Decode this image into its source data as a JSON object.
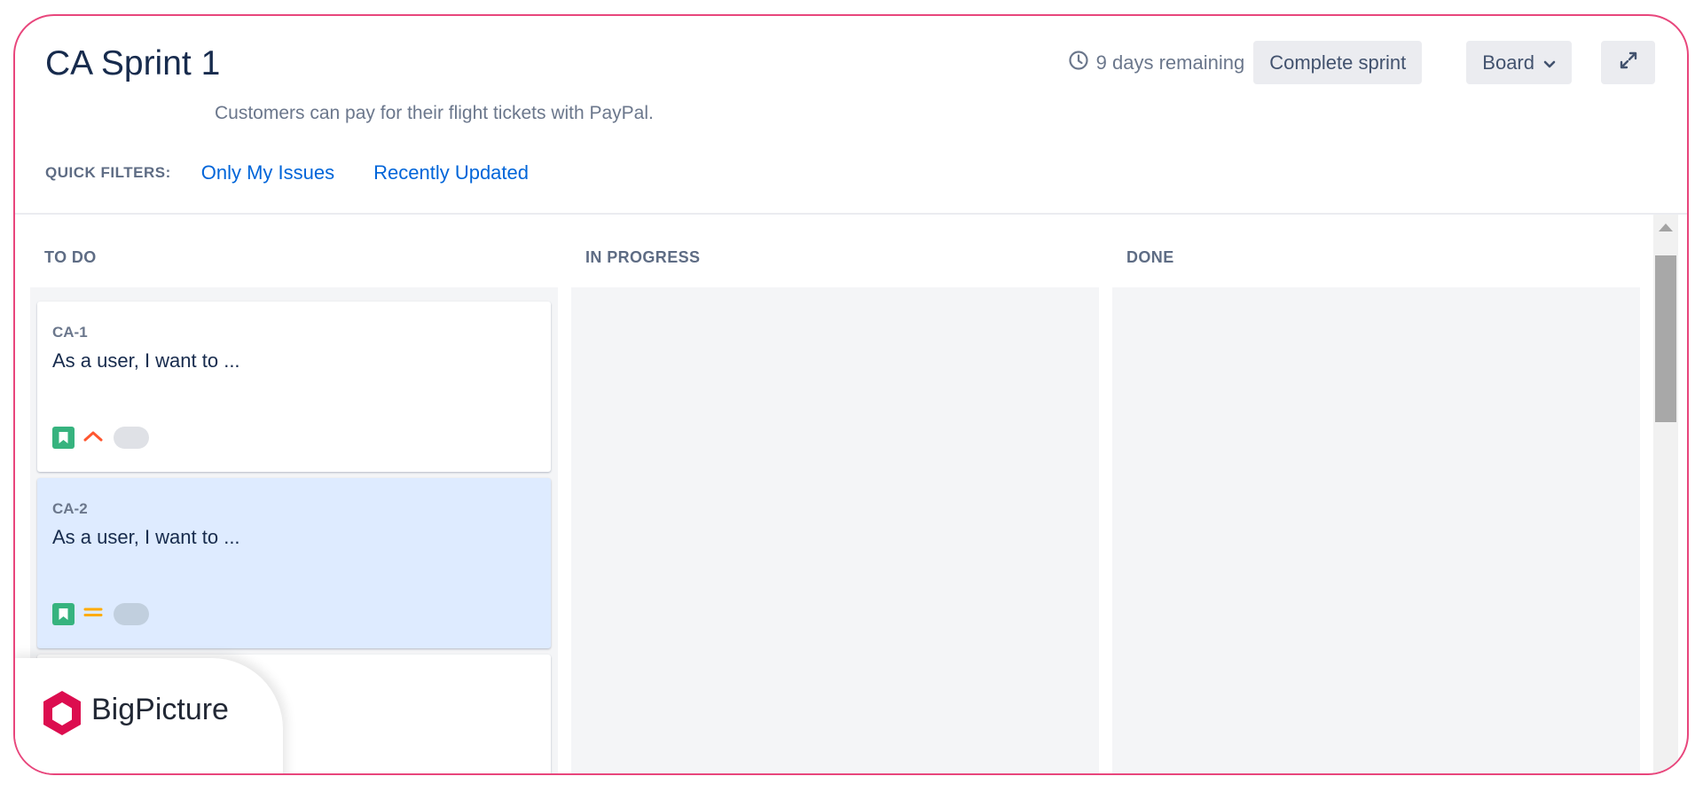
{
  "sprint": {
    "title": "CA Sprint 1",
    "goal": "Customers can pay for their flight tickets with PayPal.",
    "remaining": "9 days remaining",
    "complete_label": "Complete sprint",
    "board_label": "Board"
  },
  "quick_filters": {
    "label": "QUICK FILTERS:",
    "items": [
      "Only My Issues",
      "Recently Updated"
    ]
  },
  "columns": [
    {
      "title": "TO DO"
    },
    {
      "title": "IN PROGRESS"
    },
    {
      "title": "DONE"
    }
  ],
  "cards": [
    {
      "key": "CA-1",
      "summary": "As a user, I want to ...",
      "type_icon": "story-icon",
      "priority_icon": "priority-high-icon",
      "priority_color": "#ff5630"
    },
    {
      "key": "CA-2",
      "summary": "As a user, I want to ...",
      "type_icon": "story-icon",
      "priority_icon": "priority-medium-icon",
      "priority_color": "#ffab00"
    }
  ],
  "brand": {
    "name": "BigPicture",
    "accent": "#e8467c",
    "logo_color": "#dc0d4f"
  },
  "colors": {
    "link": "#0065d9",
    "story": "#36b37e",
    "selected_card": "#deebff"
  }
}
